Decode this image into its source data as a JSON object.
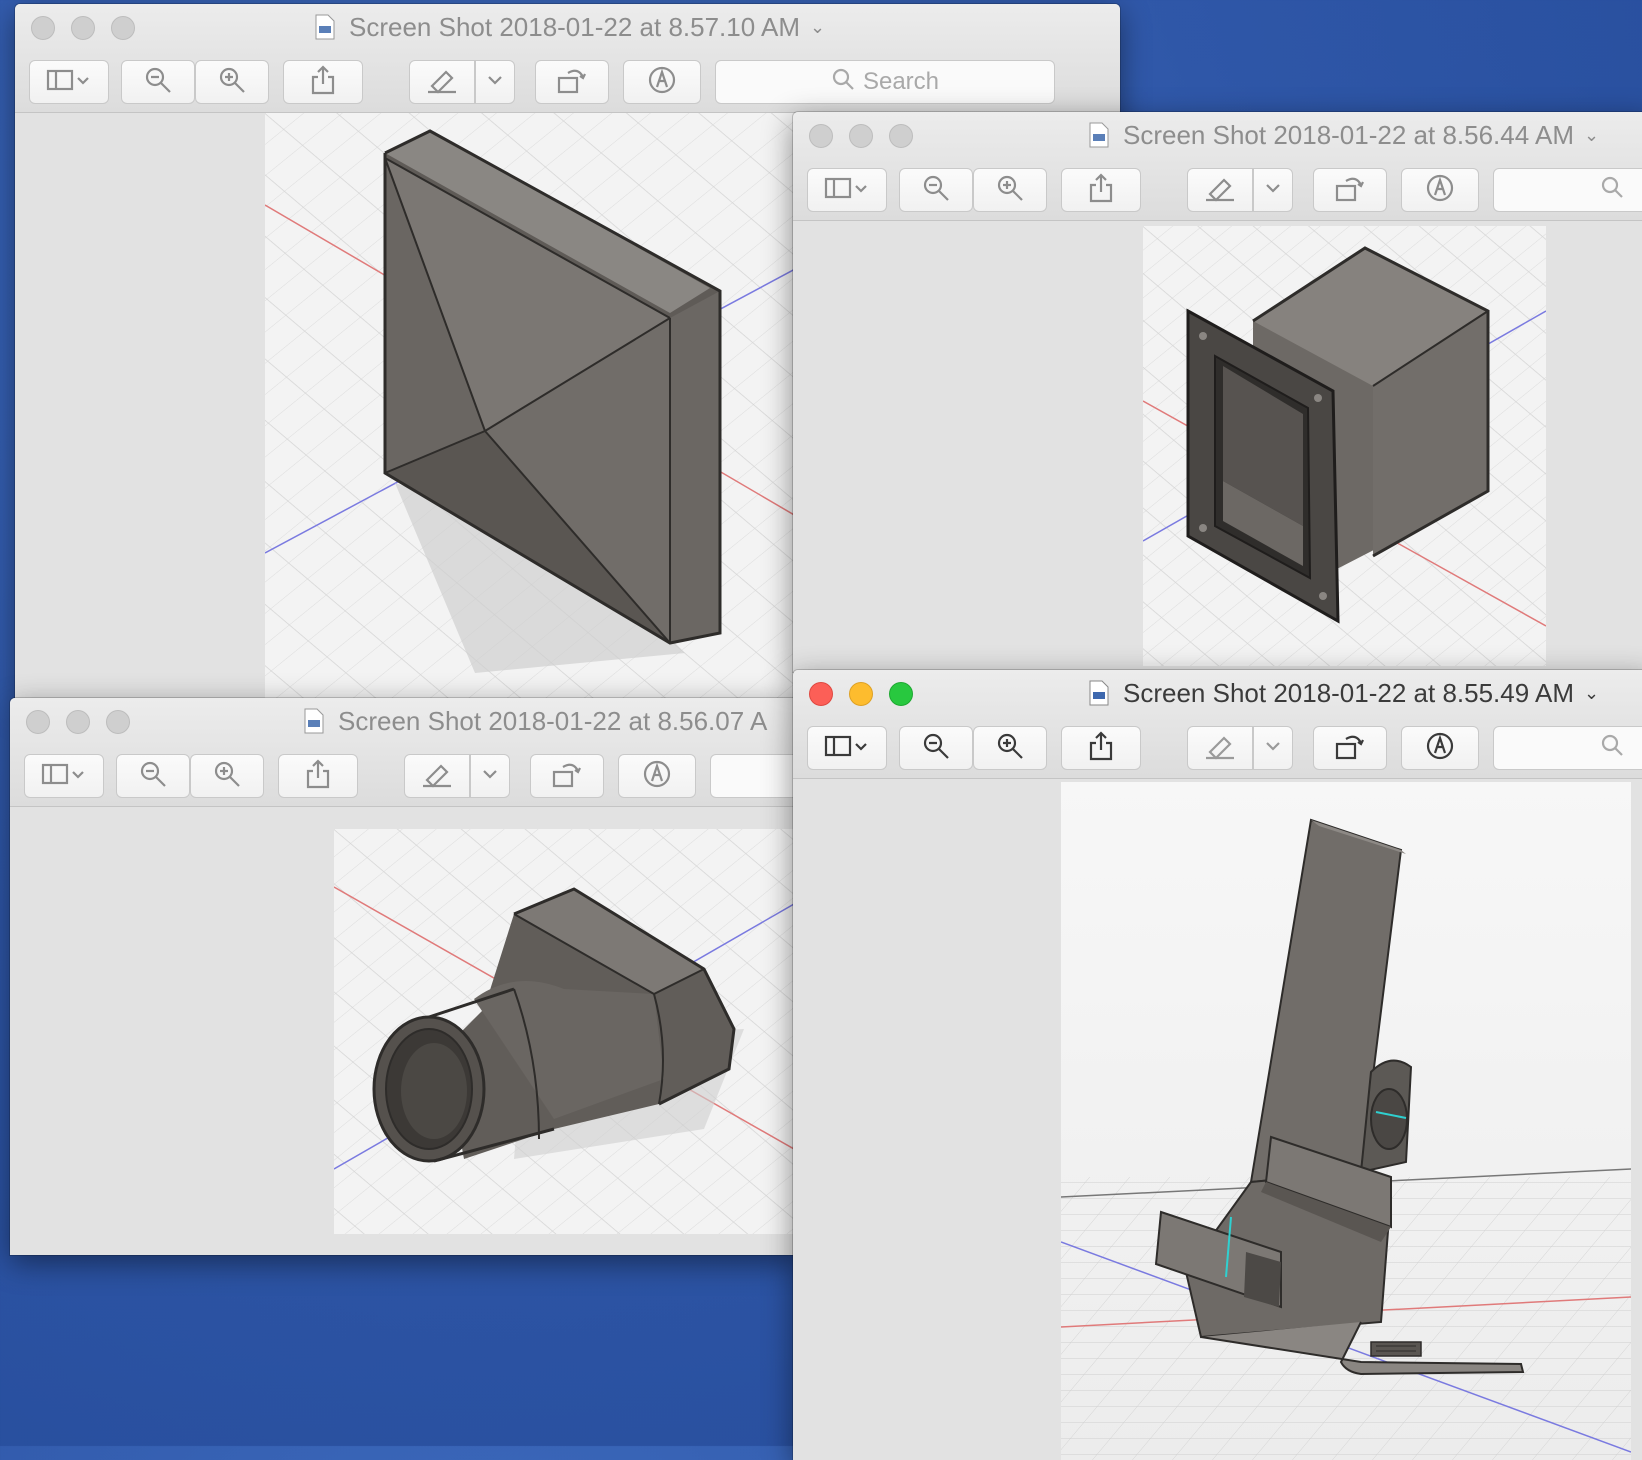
{
  "windows": [
    {
      "title": "Screen Shot 2018-01-22 at 8.57.10 AM",
      "search_placeholder": "Search"
    },
    {
      "title": "Screen Shot 2018-01-22 at 8.56.44 AM"
    },
    {
      "title": "Screen Shot 2018-01-22 at 8.56.07 A"
    },
    {
      "title": "Screen Shot 2018-01-22 at 8.55.49 AM"
    }
  ],
  "toolbar_icons": [
    "sidebar-icon",
    "zoom-out-icon",
    "zoom-in-icon",
    "share-icon",
    "markup-pen-icon",
    "rotate-icon",
    "annotate-icon",
    "search-icon"
  ],
  "colors": {
    "desktop": "#2f57a8",
    "close": "#fc5f57",
    "minimize": "#fdbc2e",
    "zoom": "#28c83f",
    "model_gray": "#66625d"
  }
}
